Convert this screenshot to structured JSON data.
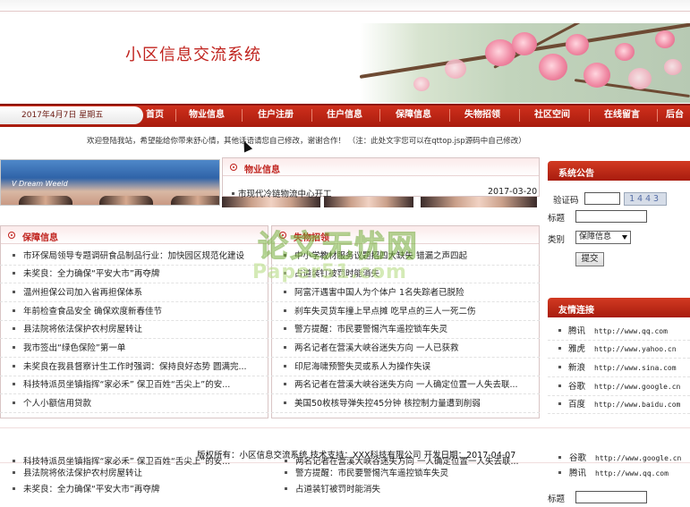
{
  "site": {
    "title": "小区信息交流系统"
  },
  "nav": {
    "date": "2017年4月7日 星期五",
    "items": [
      "首页",
      "物业信息",
      "住户注册",
      "住户信息",
      "保障信息",
      "失物招领",
      "社区空间",
      "在线留言",
      "后台"
    ]
  },
  "welcome": {
    "text": "欢迎登陆我站，希望能给你带来舒心情，其他话语请您自己修改，谢谢合作！ （注：此处文字您可以在qttop.jsp源码中自己修改）"
  },
  "photo_strip": {
    "caption": "V Dream Weeld"
  },
  "property_info": {
    "title": "物业信息",
    "items": [
      {
        "text": "市现代冷链物流中心开工",
        "date": "2017-03-20"
      }
    ]
  },
  "security_info": {
    "title": "保障信息",
    "items": [
      "市环保局领导专题调研食品制品行业：加快园区规范化建设",
      "未奖良：全力确保“平安大市”再夺牌",
      "温州担保公司加入省再担保体系",
      "年前检查食品安全 确保欢度新春佳节",
      "县法院将依法保护农村房屋转让",
      "我市签出“绿色保险”第一单",
      "未奖良在我县督察计生工作时强调：保持良好态势 圆满完...",
      "科技特派员坐镇指挥“家必禾” 保卫百姓“舌尖上”的安...",
      "个人小额信用贷款"
    ]
  },
  "lost_found": {
    "title": "失物招领",
    "items": [
      "中小学教材服务议题招四大缺失 错漏之声四起",
      "占道装钉被罚时能消失",
      "阿富汗遇害中国人为个体户 1名失踪者已脱险",
      "刹车失灵货车撞上早点摊 吃早点的三人一死二伤",
      "警方提醒：市民要警惕汽车遥控锁车失灵",
      "两名记者在营溪大峡谷迷失方向 一人已获救",
      "印尼海啸预警失灵或系人为操作失误",
      "两名记者在营溪大峡谷迷失方向 一人确定位置一人失去联...",
      "美国50枚核导弹失控45分钟 核控制力量遭到削弱"
    ]
  },
  "notice": {
    "title": "系统公告",
    "captcha_label": "验证码",
    "captcha_value": "1443",
    "title_label": "标题",
    "category_label": "类别",
    "category_selected": "保障信息",
    "submit_label": "提交"
  },
  "links": {
    "title": "友情连接",
    "items": [
      {
        "name": "腾讯",
        "url": "http://www.qq.com"
      },
      {
        "name": "雅虎",
        "url": "http://www.yahoo.cn"
      },
      {
        "name": "新浪",
        "url": "http://www.sina.com"
      },
      {
        "name": "谷歌",
        "url": "http://www.google.cn"
      },
      {
        "name": "百度",
        "url": "http://www.baidu.com"
      }
    ]
  },
  "footer": {
    "text": "版权所有：小区信息交流系统  技术支持：XXX科技有限公司  开发日期：2017-04-07"
  },
  "watermark": {
    "cn": "论文无忧网",
    "en": "Paper51.com"
  },
  "overlap_rows": {
    "left": [
      "科技特派员坐镇指挥“家必禾” 保卫百姓“舌尖上”的安...",
      "县法院将依法保护农村房屋转让",
      "未奖良：全力确保“平安大市”再夺牌"
    ],
    "middle": [
      "两名记者在营溪大峡谷迷失方向 一人确定位置一人失去联...",
      "警方提醒：市民要警惕汽车遥控锁车失灵",
      "占道装钉被罚时能消失"
    ],
    "right": [
      {
        "name": "谷歌",
        "url": "http://www.google.cn"
      },
      {
        "name": "腾讯",
        "url": "http://www.qq.com"
      }
    ],
    "right_title_label": "标题"
  }
}
